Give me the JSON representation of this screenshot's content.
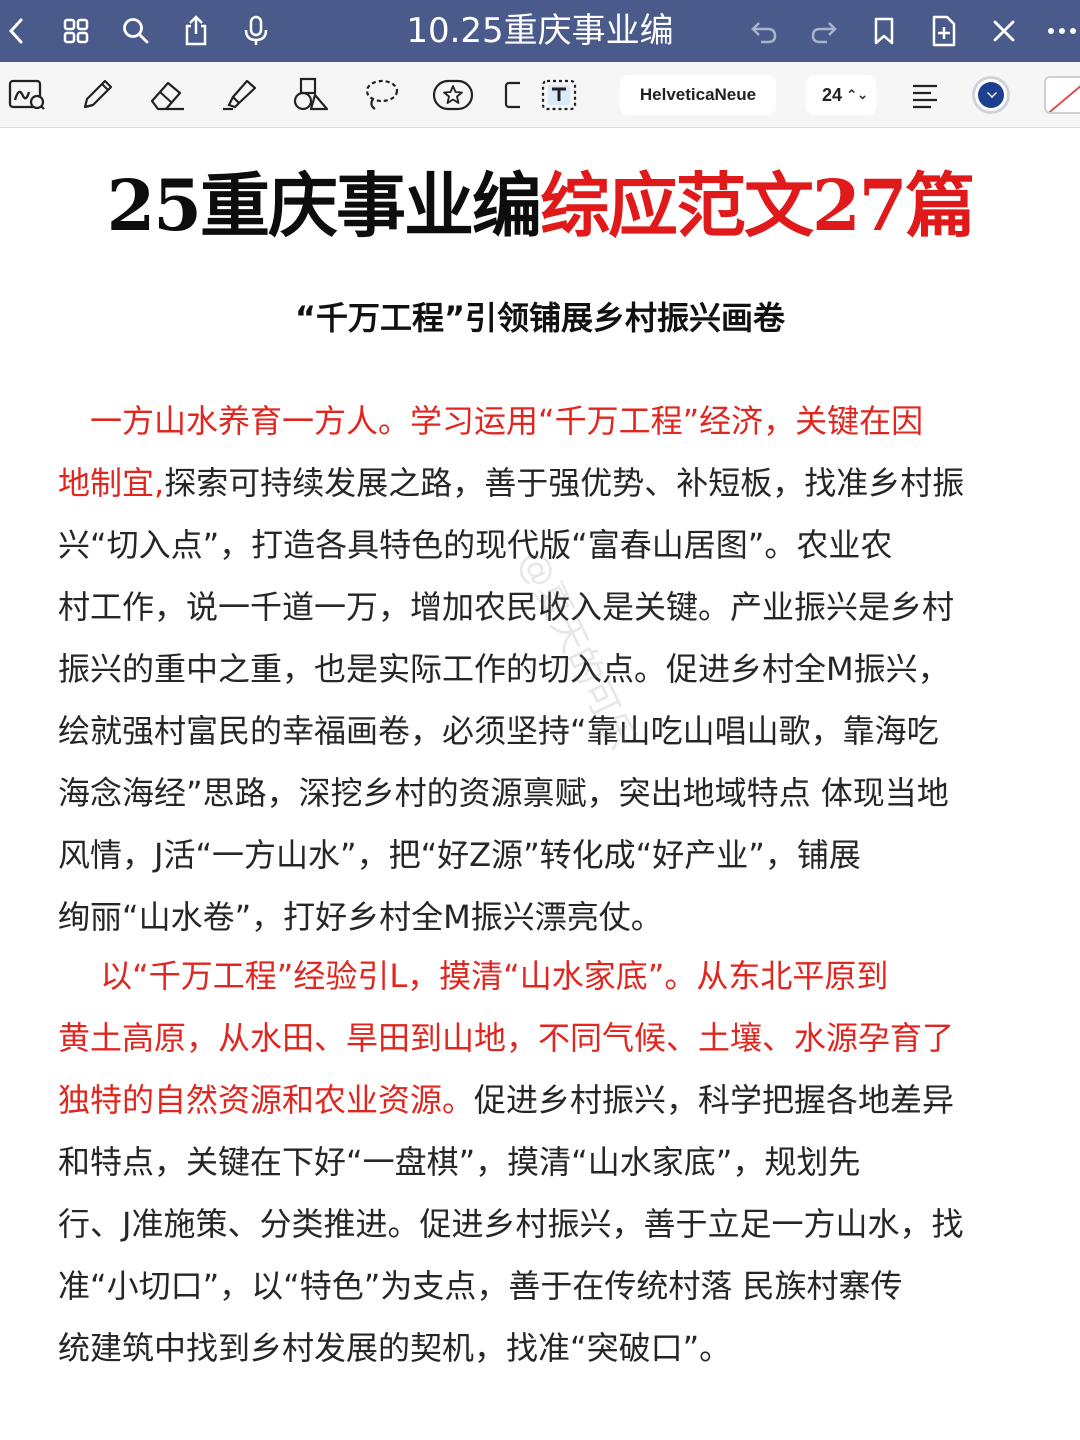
{
  "nav": {
    "title": "10.25重庆事业编"
  },
  "toolbar": {
    "font_name": "HelveticaNeue",
    "font_size": "24",
    "stroke_color": "#1e3f8f"
  },
  "document": {
    "title_black": "25重庆事业编",
    "title_red": "综应范文27篇",
    "subtitle": "“千万工程”引领铺展乡村振兴画卷",
    "paragraph1": [
      {
        "red": "　一方山水养育一方人。学习运用“千万工程”经济，关键在因",
        "black": ""
      },
      {
        "red": "地制宜,",
        "black": "探索可持续发展之路，善于强优势、补短板，找准乡村振"
      },
      {
        "red": "",
        "black": "兴“切入点”，打造各具特色的现代版“富春山居图”。农业农"
      },
      {
        "red": "",
        "black": "村工作，说一千道一万，增加农民收入是关键。产业振兴是乡村"
      },
      {
        "red": "",
        "black": "振兴的重中之重，也是实际工作的切入点。促进乡村全M振兴，"
      },
      {
        "red": "",
        "black": "绘就强村富民的幸福画卷，必须坚持“靠山吃山唱山歌，靠海吃"
      },
      {
        "red": "",
        "black": "海念海经”思路，深挖乡村的资源禀赋，突出地域特点 体现当地"
      },
      {
        "red": "",
        "black": "风情，J活“一方山水”，把“好Z源”转化成“好产业”，铺展"
      },
      {
        "red": "",
        "black": "绚丽“山水卷”，打好乡村全M振兴漂亮仗。"
      }
    ],
    "paragraph2": [
      {
        "red": "　 以“千万工程”经验引L，摸清“山水家底”。从东北平原到",
        "black": ""
      },
      {
        "red": "黄土高原，从水田、旱田到山地，不同气候、土壤、水源孕育了",
        "black": ""
      },
      {
        "red": "独特的自然资源和农业资源。",
        "black": "促进乡村振兴，科学把握各地差异"
      },
      {
        "red": "",
        "black": "和特点，关键在下好“一盘棋”，摸清“山水家底”，规划先"
      },
      {
        "red": "",
        "black": "行、J准施策、分类推进。促进乡村振兴，善于立足一方山水，找"
      },
      {
        "red": "",
        "black": "准“小切口”，以“特色”为支点，善于在传统村落 民族村寨传"
      },
      {
        "red": "",
        "black": "统建筑中找到乡村发展的契机，找准“突破口”。"
      }
    ]
  }
}
